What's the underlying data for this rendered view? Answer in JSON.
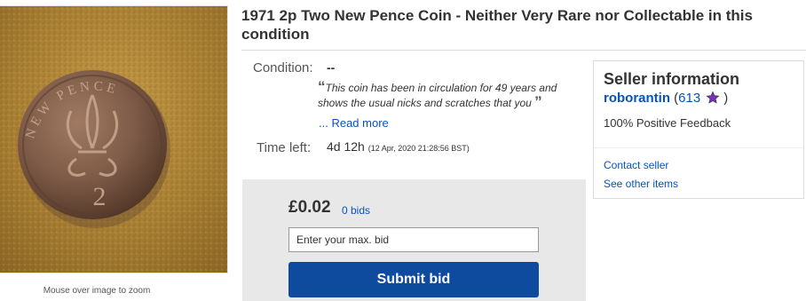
{
  "item": {
    "title": "1971 2p Two New Pence Coin - Neither Very Rare nor Collectable in this condition",
    "image_alt": "2p coin on sand",
    "coin_text": "NEW PENCE",
    "coin_numeral": "2",
    "zoom_hint": "Mouse over image to zoom"
  },
  "condition": {
    "label": "Condition:",
    "value": "--",
    "quote": "This coin has been in circulation for 49 years and shows the usual nicks and scratches that you",
    "read_more": "... Read more"
  },
  "time_left": {
    "label": "Time left:",
    "value": "4d 12h",
    "detail": "(12 Apr, 2020  21:28:56 BST)"
  },
  "bid": {
    "price": "£0.02",
    "bids": "0 bids",
    "input_placeholder": "Enter your max. bid",
    "submit_label": "Submit bid"
  },
  "seller": {
    "heading": "Seller information",
    "name": "roborantin",
    "score": "613",
    "feedback": "100% Positive Feedback",
    "contact_label": "Contact seller",
    "other_items_label": "See other items"
  },
  "colors": {
    "link": "#0654ba",
    "button": "#0e4b9f",
    "bid_box_bg": "#e8e8e8",
    "star": "#7b2fbe"
  }
}
